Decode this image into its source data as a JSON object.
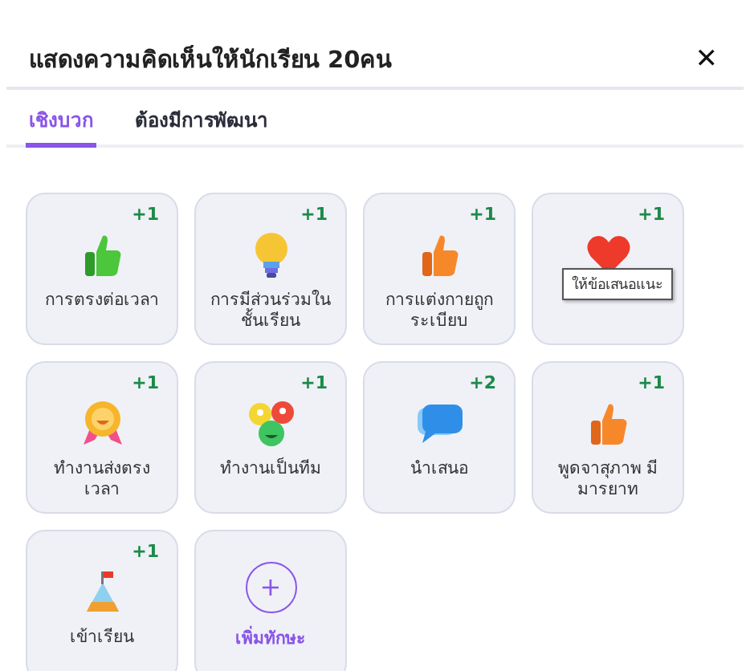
{
  "dialog": {
    "title": "แสดงความคิดเห็นให้นักเรียน 20คน",
    "close": "✕"
  },
  "tabs": [
    {
      "label": "เชิงบวก",
      "selected": true
    },
    {
      "label": "ต้องมีการพัฒนา",
      "selected": false
    }
  ],
  "cards": [
    {
      "kind": "skill",
      "count": "+1",
      "label": "การตรงต่อเวลา"
    },
    {
      "kind": "skill",
      "count": "+1",
      "label": "การมีส่วนร่วมในชั้นเรียน"
    },
    {
      "kind": "skill",
      "count": "+1",
      "label": "การแต่งกายถูกระเบียบ"
    },
    {
      "kind": "skill",
      "count": "+1",
      "tooltip": "ให้ข้อเสนอแนะ"
    },
    {
      "kind": "skill",
      "count": "+1",
      "label": "ทำงานส่งตรงเวลา"
    },
    {
      "kind": "skill",
      "count": "+1",
      "label": "ทำงานเป็นทีม"
    },
    {
      "kind": "skill",
      "count": "+2",
      "label": "นำเสนอ"
    },
    {
      "kind": "skill",
      "count": "+1",
      "label": "พูดจาสุภาพ มีมารยาท"
    },
    {
      "kind": "skill",
      "count": "+1",
      "label": "เข้าเรียน"
    },
    {
      "kind": "add",
      "label": "เพิ่มทักษะ",
      "symbol": "+"
    }
  ]
}
